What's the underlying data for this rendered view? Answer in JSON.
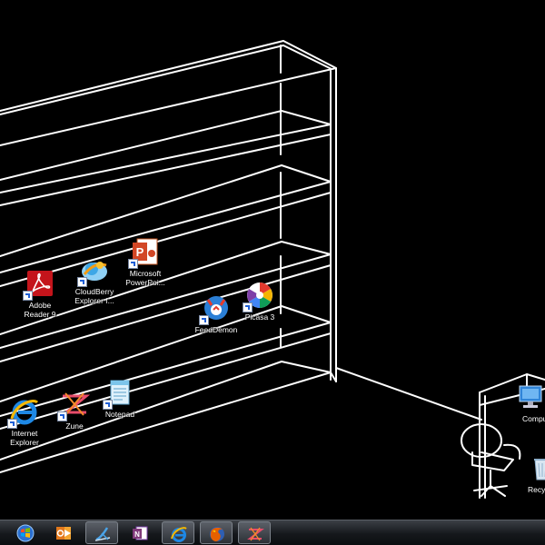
{
  "desktop": {
    "icons": [
      {
        "key": "adobe-reader",
        "label": "Adobe\nReader 9",
        "icon": "adobe-reader-icon"
      },
      {
        "key": "cloudberry",
        "label": "CloudBerry\nExplorer f...",
        "icon": "cloudberry-icon"
      },
      {
        "key": "powerpoint",
        "label": "Microsoft\nPowerPoi...",
        "icon": "powerpoint-icon"
      },
      {
        "key": "feeddemon",
        "label": "FeedDemon",
        "icon": "feeddemon-icon"
      },
      {
        "key": "picasa",
        "label": "Picasa 3",
        "icon": "picasa-icon"
      },
      {
        "key": "internet-explorer",
        "label": "Internet\nExplorer",
        "icon": "internet-explorer-icon"
      },
      {
        "key": "zune",
        "label": "Zune",
        "icon": "zune-icon"
      },
      {
        "key": "notepad",
        "label": "Notepad",
        "icon": "notepad-icon"
      },
      {
        "key": "computer",
        "label": "Compu",
        "icon": "computer-icon"
      },
      {
        "key": "recycle-bin",
        "label": "Recyc",
        "icon": "recycle-bin-icon"
      }
    ]
  },
  "taskbar": {
    "buttons": [
      {
        "name": "start-orb",
        "icon": "start-orb-icon"
      },
      {
        "name": "outlook",
        "icon": "outlook-icon"
      },
      {
        "name": "visual-studio",
        "icon": "visual-studio-icon"
      },
      {
        "name": "onenote",
        "icon": "onenote-icon"
      },
      {
        "name": "internet-explorer",
        "icon": "internet-explorer-icon"
      },
      {
        "name": "firefox",
        "icon": "firefox-icon"
      },
      {
        "name": "zune",
        "icon": "zune-icon"
      }
    ]
  }
}
